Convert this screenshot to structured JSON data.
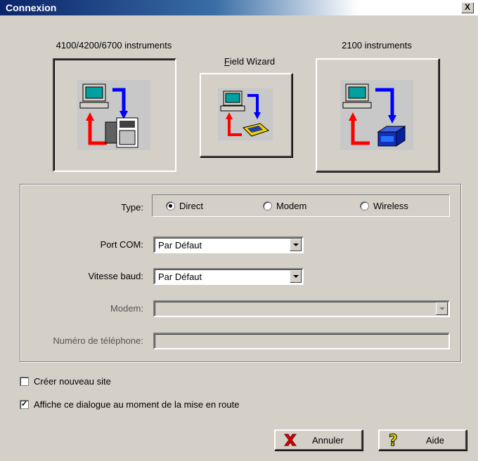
{
  "window": {
    "title": "Connexion",
    "close_label": "X"
  },
  "instruments": {
    "left_label": "4100/4200/6700 instruments",
    "middle_label": "Field Wizard",
    "right_label": "2100 instruments"
  },
  "form": {
    "type_label": "Type:",
    "type_options": [
      "Direct",
      "Modem",
      "Wireless"
    ],
    "type_selected": "Direct",
    "port_label": "Port COM:",
    "port_value": "Par Défaut",
    "baud_label": "Vitesse baud:",
    "baud_value": "Par Défaut",
    "modem_label": "Modem:",
    "modem_value": "",
    "phone_label": "Numéro de téléphone:",
    "phone_value": ""
  },
  "options": {
    "new_site_label": "Créer nouveau site",
    "new_site_checked": false,
    "show_dialog_label": "Affiche ce dialogue au moment de la mise en route",
    "show_dialog_checked": true
  },
  "buttons": {
    "cancel_label": "Annuler",
    "help_label": "Aide"
  },
  "colors": {
    "titlebar": "#0a246a",
    "face": "#d4d0c8",
    "arrow_red": "#ff0000",
    "arrow_blue": "#0000ff"
  }
}
